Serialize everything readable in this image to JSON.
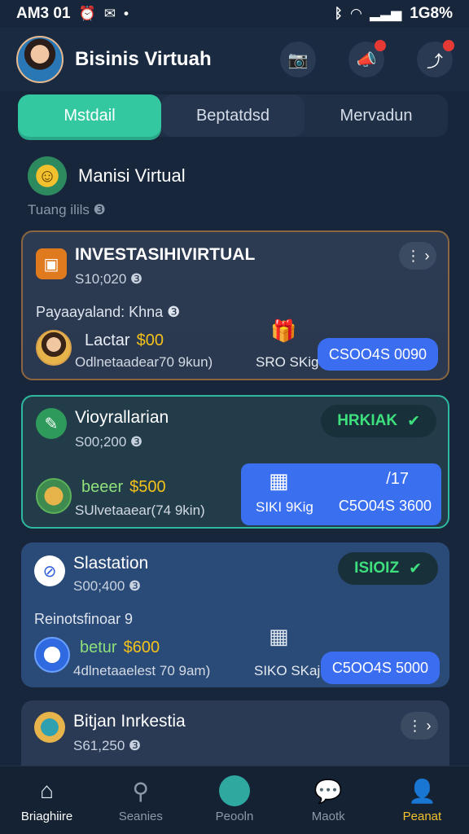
{
  "status_bar": {
    "time": "AM3 01",
    "right_text": "1G8%"
  },
  "header": {
    "title": "Bisinis Virtuah"
  },
  "tabs": [
    {
      "label": "Mstdail"
    },
    {
      "label": "Beptatdsd"
    },
    {
      "label": "Mervadun"
    }
  ],
  "section": {
    "title": "Manisi Virtual",
    "subtitle": "Tuang ilils ❸"
  },
  "cards": [
    {
      "title": "INVESTASIHIVIRTUAL",
      "amount": "S10;020 ❸",
      "row_label": "Payaayaland: Khna ❸",
      "mini_label": "Lactar",
      "mini_money": "$00",
      "mini_sub": "Odlnetaadear70 9kun)",
      "mid_text": "SRO SKig",
      "button": "CSOO4S 0090"
    },
    {
      "title": "Vioyrallarian",
      "amount": "S00;200 ❸",
      "status": "HRKIAK",
      "mini_label": "beeer",
      "mini_money": "$500",
      "mini_sub": "SUlvetaaear(74 9kin)",
      "panel_left": "SIKI 9Kig",
      "panel_top": "/17",
      "panel_right": "C5O04S 3600"
    },
    {
      "title": "Slastation",
      "amount": "S00;400 ❸",
      "status": "ISIOIZ",
      "row_label": "Reinotsfinoar 9",
      "mini_label": "betur",
      "mini_money": "$600",
      "mini_sub": "4dlnetaaelest 70 9am)",
      "mid_text": "SIKO SKaj",
      "button": "C5OO4S 5000"
    },
    {
      "title": "Bitjan Inrkestia",
      "amount": "S61,250 ❸"
    }
  ],
  "bottom_nav": [
    {
      "label": "Briaghiire"
    },
    {
      "label": "Seanies"
    },
    {
      "label": "Peooln"
    },
    {
      "label": "Maotk"
    },
    {
      "label": "Peanat"
    }
  ],
  "colors": {
    "accent": "#34c8a1",
    "button_blue": "#3b6df0",
    "money": "#f4c21a",
    "status_green": "#3ee07e"
  }
}
